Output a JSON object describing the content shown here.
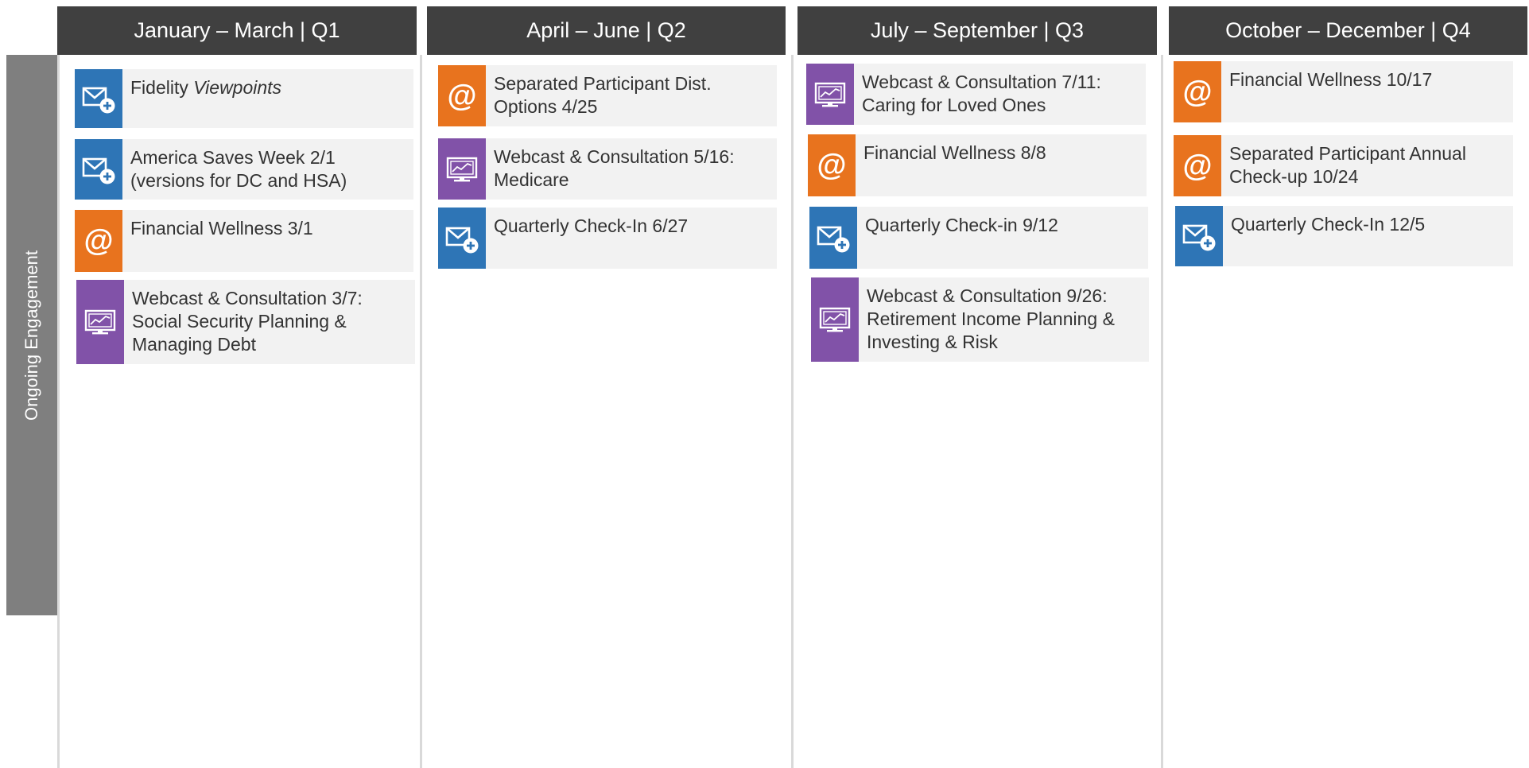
{
  "side_label": "Ongoing Engagement",
  "colors": {
    "header_bg": "#404040",
    "side_band": "#7f7f7f",
    "card_bg": "#f2f2f2",
    "email": "#2e75b6",
    "at": "#e8731e",
    "webcast": "#8152a8"
  },
  "quarters": [
    {
      "header": "January – March | Q1",
      "items": [
        {
          "icon": "email-add-icon",
          "text": "Fidelity ",
          "emphasis": "Viewpoints"
        },
        {
          "icon": "email-add-icon",
          "text": "America Saves Week 2/1 (versions for DC and HSA)"
        },
        {
          "icon": "at-sign-icon",
          "text": "Financial Wellness 3/1"
        },
        {
          "icon": "webcast-monitor-icon",
          "text": "Webcast & Consultation 3/7: Social Security Planning & Managing Debt"
        }
      ]
    },
    {
      "header": "April – June | Q2",
      "items": [
        {
          "icon": "at-sign-icon",
          "text": "Separated Participant Dist. Options 4/25"
        },
        {
          "icon": "webcast-monitor-icon",
          "text": "Webcast & Consultation 5/16: Medicare"
        },
        {
          "icon": "email-add-icon",
          "text": "Quarterly Check-In 6/27"
        }
      ]
    },
    {
      "header": "July – September | Q3",
      "items": [
        {
          "icon": "webcast-monitor-icon",
          "text": "Webcast & Consultation 7/11: Caring for Loved Ones"
        },
        {
          "icon": "at-sign-icon",
          "text": "Financial Wellness 8/8"
        },
        {
          "icon": "email-add-icon",
          "text": "Quarterly Check-in 9/12"
        },
        {
          "icon": "webcast-monitor-icon",
          "text": "Webcast & Consultation 9/26: Retirement Income Planning & Investing & Risk"
        }
      ]
    },
    {
      "header": "October – December | Q4",
      "items": [
        {
          "icon": "at-sign-icon",
          "text": "Financial Wellness 10/17"
        },
        {
          "icon": "at-sign-icon",
          "text": "Separated Participant Annual Check-up 10/24"
        },
        {
          "icon": "email-add-icon",
          "text": "Quarterly Check-In 12/5"
        }
      ]
    }
  ]
}
